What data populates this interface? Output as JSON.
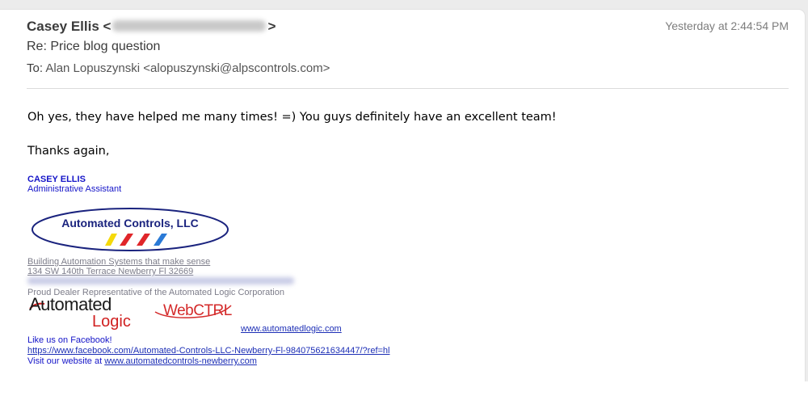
{
  "header": {
    "sender_name": "Casey Ellis",
    "timestamp": "Yesterday at 2:44:54 PM",
    "subject": "Re: Price blog question",
    "to_label": "To:",
    "to_value": "Alan Lopuszynski <alopuszynski@alpscontrols.com>"
  },
  "body": {
    "line1": "Oh yes, they have helped me many times! =)   You guys definitely have an excellent team!",
    "line2": "Thanks again,"
  },
  "signature": {
    "name": "CASEY ELLIS",
    "title": "Administrative Assistant",
    "company_logo_text": "Automated Controls, LLC",
    "tagline": "Building Automation Systems that make sense",
    "address": "134 SW 140th Terrace Newberry Fl 32669",
    "dealer": "Proud Dealer Representative of the Automated Logic Corporation",
    "al_logo_top": "Automated",
    "al_logo_bottom": "Logic",
    "webctrl_logo": "WebCTRL",
    "al_site": "www.automatedlogic.com",
    "facebook_label": "Like us on Facebook!",
    "facebook_url": "https://www.facebook.com/Automated-Controls-LLC-Newberry-Fl-984075621634447/?ref=hl",
    "visit_prefix": "Visit our website at ",
    "website": "www.automatedcontrols-newberry.com"
  },
  "colors": {
    "signature_blue": "#1414c8",
    "link_blue": "#1d2fb6",
    "logo_navy": "#1a237e",
    "stripe_yellow": "#f5d90a",
    "stripe_red": "#e0262a",
    "stripe_blue": "#2a7ad6"
  }
}
